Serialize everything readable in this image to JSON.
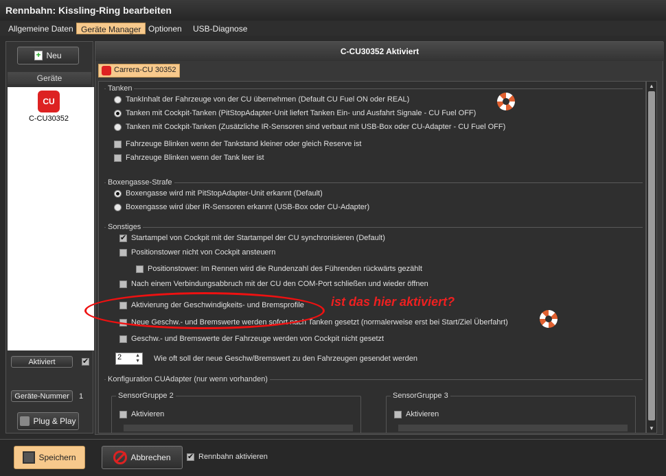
{
  "window": {
    "title": "Rennbahn: Kissling-Ring bearbeiten"
  },
  "menu": [
    "Allgemeine Daten",
    "Geräte Manager",
    "Optionen",
    "USB-Diagnose"
  ],
  "left": {
    "new_button": "Neu",
    "devices_header": "Geräte",
    "device_name": "C-CU30352",
    "activated_label": "Aktiviert",
    "device_number_label": "Geräte-Nummer",
    "device_number": "1",
    "plug_play_button": "Plug & Play"
  },
  "main": {
    "title": "C-CU30352 Aktiviert",
    "tab": "Carrera-CU 30352"
  },
  "tanken": {
    "title": "Tanken",
    "options": [
      "TankInhalt der Fahrzeuge von der CU übernehmen (Default CU Fuel ON oder REAL)",
      "Tanken mit Cockpit-Tanken (PitStopAdapter-Unit liefert Tanken Ein- und Ausfahrt Signale - CU Fuel OFF)",
      "Tanken mit Cockpit-Tanken (Zusätzliche IR-Sensoren sind verbaut mit USB-Box oder CU-Adapter - CU Fuel OFF)"
    ],
    "checks": [
      "Fahrzeuge Blinken wenn der Tankstand kleiner oder gleich Reserve ist",
      "Fahrzeuge Blinken wenn der Tank leer ist"
    ]
  },
  "boxengasse": {
    "title": "Boxengasse-Strafe",
    "options": [
      "Boxengasse wird mit PitStopAdapter-Unit erkannt (Default)",
      "Boxengasse wird über IR-Sensoren erkannt (USB-Box oder CU-Adapter)"
    ]
  },
  "sonstiges": {
    "title": "Sonstiges",
    "items": [
      "Startampel von Cockpit mit der Startampel der CU synchronisieren (Default)",
      "Positionstower nicht von Cockpit ansteuern",
      "Positionstower: Im Rennen wird die Rundenzahl des Führenden rückwärts gezählt",
      "Nach einem Verbindungsabbruch mit der CU den COM-Port schließen und wieder öffnen",
      "Aktivierung der Geschwindigkeits- und Bremsprofile",
      "Neue Geschw.- und Bremswerte werden sofort nach Tanken gesetzt (normalerweise erst bei Start/Ziel Überfahrt)",
      "Geschw.- und Bremswerte der Fahrzeuge werden von Cockpit nicht gesetzt"
    ],
    "spin_value": "2",
    "spin_label": "Wie oft soll der neue Geschw/Bremswert zu den Fahrzeugen gesendet werden"
  },
  "cuadapter": {
    "title": "Konfiguration CUAdapter (nur wenn vorhanden)",
    "group2": "SensorGruppe 2",
    "group3": "SensorGruppe 3",
    "activate": "Aktivieren"
  },
  "annotation": {
    "text": "ist das hier aktiviert?"
  },
  "bottom": {
    "save": "Speichern",
    "cancel": "Abbrechen",
    "activate_track": "Rennbahn aktivieren"
  }
}
